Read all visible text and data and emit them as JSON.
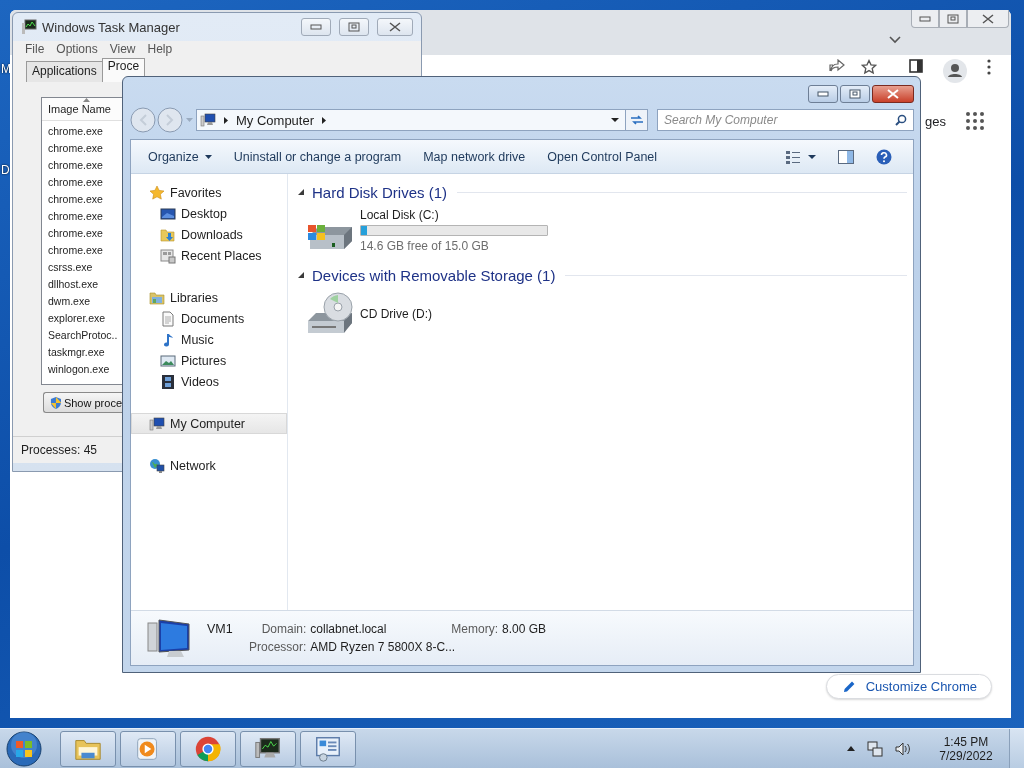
{
  "desktop": {
    "icon_labels": [
      "M",
      "D"
    ]
  },
  "browser": {
    "page_link": "ges",
    "customize_button": "Customize Chrome"
  },
  "task_manager": {
    "title": "Windows Task Manager",
    "menu": [
      "File",
      "Options",
      "View",
      "Help"
    ],
    "tabs": [
      {
        "label": "Applications",
        "selected": false
      },
      {
        "label": "Proce",
        "selected": true
      }
    ],
    "column": "Image Name",
    "processes": [
      "chrome.exe",
      "chrome.exe",
      "chrome.exe",
      "chrome.exe",
      "chrome.exe",
      "chrome.exe",
      "chrome.exe",
      "chrome.exe",
      "csrss.exe",
      "dllhost.exe",
      "dwm.exe",
      "explorer.exe",
      "SearchProtoc..",
      "taskmgr.exe",
      "winlogon.exe"
    ],
    "show_button": "Show proce",
    "status": "Processes: 45"
  },
  "explorer": {
    "nav_buttons": [
      {
        "kind": "back",
        "disabled": true
      },
      {
        "kind": "forward",
        "disabled": true
      }
    ],
    "address": "My Computer",
    "search": {
      "placeholder": "Search My Computer"
    },
    "commands": [
      {
        "label": "Organize",
        "dropdown": true
      },
      {
        "label": "Uninstall or change a program",
        "dropdown": false
      },
      {
        "label": "Map network drive",
        "dropdown": false
      },
      {
        "label": "Open Control Panel",
        "dropdown": false
      }
    ],
    "nav": [
      {
        "label": "Favorites",
        "kind": "favorites",
        "selected": false,
        "children": [
          {
            "label": "Desktop",
            "kind": "desktop",
            "selected": false
          },
          {
            "label": "Downloads",
            "kind": "downloads",
            "selected": false
          },
          {
            "label": "Recent Places",
            "kind": "recent",
            "selected": false
          }
        ]
      },
      {
        "label": "Libraries",
        "kind": "libraries",
        "selected": false,
        "children": [
          {
            "label": "Documents",
            "kind": "documents",
            "selected": false
          },
          {
            "label": "Music",
            "kind": "music",
            "selected": false
          },
          {
            "label": "Pictures",
            "kind": "pictures",
            "selected": false
          },
          {
            "label": "Videos",
            "kind": "videos",
            "selected": false
          }
        ]
      },
      {
        "label": "My Computer",
        "kind": "computer",
        "selected": true
      },
      {
        "label": "Network",
        "kind": "network",
        "selected": false
      }
    ],
    "sections": [
      {
        "title": "Hard Disk Drives (1)",
        "items": [
          {
            "name": "Local Disk (C:)",
            "kind": "disk",
            "level": 0.03,
            "reading": "14.6 GB free of 15.0 GB"
          }
        ]
      },
      {
        "title": "Devices with Removable Storage (1)",
        "items": [
          {
            "name": "CD Drive (D:)",
            "kind": "cd"
          }
        ]
      }
    ],
    "details": {
      "name": "VM1",
      "fields": [
        {
          "label": "Domain:",
          "value": "collabnet.local"
        },
        {
          "label": "Memory:",
          "value": "8.00 GB"
        },
        {
          "label": "Processor:",
          "value": "AMD Ryzen 7 5800X 8-C..."
        }
      ]
    }
  },
  "taskbar": {
    "buttons": [
      {
        "kind": "folder"
      },
      {
        "kind": "media"
      },
      {
        "kind": "browser"
      },
      {
        "kind": "monitor"
      },
      {
        "kind": "panel"
      }
    ],
    "time": "1:45 PM",
    "date": "7/29/2022"
  }
}
